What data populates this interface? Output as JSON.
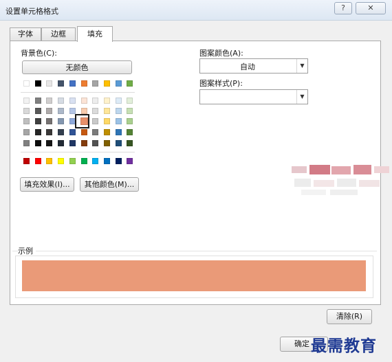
{
  "window": {
    "title": "设置单元格格式",
    "help_label": "?",
    "close_label": "✕"
  },
  "tabs": [
    {
      "label": "字体"
    },
    {
      "label": "边框"
    },
    {
      "label": "填充"
    }
  ],
  "fill": {
    "background_label": "背景色(C):",
    "no_color_label": "无颜色",
    "fill_effects_label": "填充效果(I)...",
    "more_colors_label": "其他颜色(M)...",
    "selected_color": "#E7906A"
  },
  "pattern": {
    "color_label": "图案颜色(A):",
    "color_value": "自动",
    "style_label": "图案样式(P):",
    "style_value": ""
  },
  "sample": {
    "label": "示例",
    "color": "#EA9A78"
  },
  "buttons": {
    "clear_label": "清除(R)",
    "ok_label": "确定"
  },
  "watermark": {
    "text": "最需教育"
  },
  "palette": {
    "theme_row": [
      "#FFFFFF",
      "#000000",
      "#E7E6E6",
      "#44546A",
      "#4472C4",
      "#ED7D31",
      "#A5A5A5",
      "#FFC000",
      "#5B9BD5",
      "#70AD47"
    ],
    "shade_rows": [
      [
        "#F2F2F2",
        "#808080",
        "#D0CECE",
        "#D6DCE4",
        "#D9E1F2",
        "#FCE4D6",
        "#EDEDED",
        "#FFF2CC",
        "#DDEBF7",
        "#E2EFDA"
      ],
      [
        "#D9D9D9",
        "#595959",
        "#AEAAAA",
        "#ADB9CA",
        "#B4C6E7",
        "#F8CBAD",
        "#DBDBDB",
        "#FFE699",
        "#BDD7EE",
        "#C6E0B4"
      ],
      [
        "#BFBFBF",
        "#404040",
        "#757171",
        "#8497B0",
        "#8EA9DB",
        "#F4B084",
        "#C9C9C9",
        "#FFD966",
        "#9BC2E6",
        "#A9D08E"
      ],
      [
        "#A6A6A6",
        "#262626",
        "#3A3838",
        "#333F4F",
        "#305496",
        "#C65911",
        "#7B7B7B",
        "#BF8F00",
        "#2F75B5",
        "#548235"
      ],
      [
        "#808080",
        "#0D0D0D",
        "#161616",
        "#222B35",
        "#203764",
        "#833C0C",
        "#525252",
        "#806000",
        "#1F4E78",
        "#375623"
      ]
    ],
    "standard_row": [
      "#C00000",
      "#FF0000",
      "#FFC000",
      "#FFFF00",
      "#92D050",
      "#00B050",
      "#00B0F0",
      "#0070C0",
      "#002060",
      "#7030A0"
    ]
  }
}
